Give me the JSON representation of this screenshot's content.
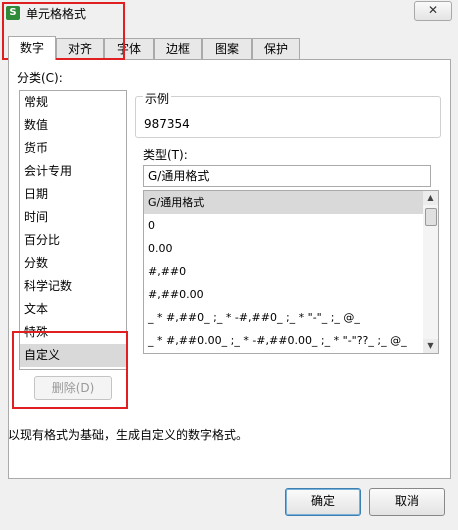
{
  "window": {
    "title": "单元格格式",
    "close_glyph": "✕",
    "app_icon_glyph": "S"
  },
  "tabs": [
    {
      "label": "数字",
      "active": true
    },
    {
      "label": "对齐"
    },
    {
      "label": "字体"
    },
    {
      "label": "边框"
    },
    {
      "label": "图案"
    },
    {
      "label": "保护"
    }
  ],
  "category": {
    "label": "分类(C):",
    "items": [
      "常规",
      "数值",
      "货币",
      "会计专用",
      "日期",
      "时间",
      "百分比",
      "分数",
      "科学记数",
      "文本",
      "特殊",
      "自定义"
    ],
    "selected": "自定义"
  },
  "example": {
    "label": "示例",
    "value": "987354"
  },
  "type": {
    "label": "类型(T):",
    "input_value": "G/通用格式",
    "items": [
      "G/通用格式",
      "0",
      "0.00",
      "#,##0",
      "#,##0.00",
      "_ * #,##0_ ;_ * -#,##0_ ;_ * \"-\"_ ;_ @_",
      "_ * #,##0.00_ ;_ * -#,##0.00_ ;_ * \"-\"??_ ;_ @_"
    ],
    "selected": "G/通用格式"
  },
  "buttons": {
    "delete": "删除(D)",
    "ok": "确定",
    "cancel": "取消"
  },
  "description": "以现有格式为基础，生成自定义的数字格式。",
  "colors": {
    "highlight": "#e02020",
    "selection": "#d9d9d9",
    "app_icon": "#2e8b3a"
  }
}
